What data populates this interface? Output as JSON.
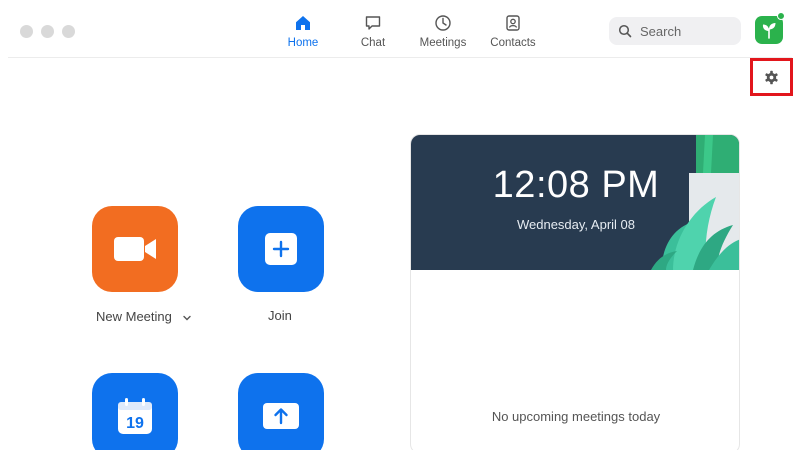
{
  "window": {
    "traffic_lights": [
      "close",
      "minimize",
      "zoom"
    ]
  },
  "nav": {
    "items": [
      {
        "label": "Home",
        "icon": "home-icon",
        "active": true
      },
      {
        "label": "Chat",
        "icon": "chat-icon",
        "active": false
      },
      {
        "label": "Meetings",
        "icon": "clock-icon",
        "active": false
      },
      {
        "label": "Contacts",
        "icon": "contacts-icon",
        "active": false
      }
    ]
  },
  "search": {
    "placeholder": "Search",
    "icon": "search-icon"
  },
  "profile": {
    "avatar_icon": "leaf-icon",
    "status": "online"
  },
  "settings": {
    "icon": "gear-icon",
    "highlighted": true
  },
  "actions": {
    "new_meeting": {
      "label": "New Meeting",
      "icon": "video-camera-icon",
      "has_dropdown": true
    },
    "join": {
      "label": "Join",
      "icon": "plus-icon"
    },
    "schedule": {
      "label": "",
      "icon": "calendar-icon",
      "calendar_day": "19"
    },
    "share_screen": {
      "label": "",
      "icon": "upload-arrow-icon"
    }
  },
  "clock": {
    "time": "12:08 PM",
    "date": "Wednesday, April 08"
  },
  "upcoming": {
    "empty_message": "No upcoming meetings today"
  },
  "colors": {
    "accent_blue": "#0e72ed",
    "orange": "#f26d21",
    "hero_bg": "#283b50",
    "avatar_green": "#2bb24c",
    "highlight_red": "#e2161c"
  }
}
